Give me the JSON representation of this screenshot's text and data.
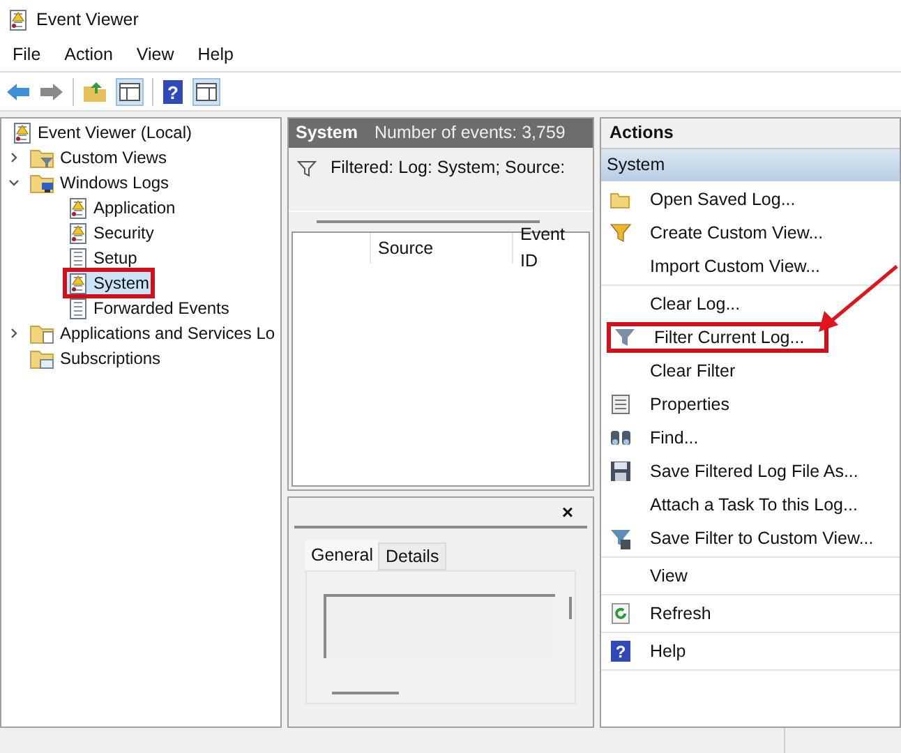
{
  "window": {
    "title": "Event Viewer"
  },
  "menu": [
    "File",
    "Action",
    "View",
    "Help"
  ],
  "toolbar": {
    "help_glyph": "?"
  },
  "tree": [
    {
      "label": "Event Viewer (Local)",
      "kind": "viewer",
      "selected": false,
      "highlighted": false,
      "children": [
        {
          "label": "Custom Views",
          "kind": "folder-filter",
          "expanded": false,
          "selected": false,
          "highlighted": false
        },
        {
          "label": "Windows Logs",
          "kind": "folder-pc",
          "expanded": true,
          "selected": false,
          "highlighted": false,
          "children": [
            {
              "label": "Application",
              "kind": "log-warn",
              "selected": false,
              "highlighted": false
            },
            {
              "label": "Security",
              "kind": "log-warn",
              "selected": false,
              "highlighted": false
            },
            {
              "label": "Setup",
              "kind": "log",
              "selected": false,
              "highlighted": false
            },
            {
              "label": "System",
              "kind": "log-warn",
              "selected": true,
              "highlighted": true
            },
            {
              "label": "Forwarded Events",
              "kind": "log",
              "selected": false,
              "highlighted": false
            }
          ]
        },
        {
          "label": "Applications and Services Lo",
          "kind": "folder",
          "expanded": false,
          "selected": false,
          "highlighted": false
        },
        {
          "label": "Subscriptions",
          "kind": "folder-sub",
          "selected": false,
          "highlighted": false
        }
      ]
    }
  ],
  "log": {
    "title": "System",
    "count": "Number of events: 3,759",
    "filter": "Filtered: Log: System; Source:",
    "columns": [
      "Source",
      "Event ID"
    ]
  },
  "preview": {
    "close": "×",
    "tabs": [
      {
        "label": "General",
        "selected": true
      },
      {
        "label": "Details",
        "selected": false
      }
    ]
  },
  "actions": {
    "title": "Actions",
    "section": "System",
    "groups": [
      [
        {
          "label": "Open Saved Log...",
          "kind": "folder",
          "highlighted": false
        },
        {
          "label": "Create Custom View...",
          "kind": "funnel",
          "highlighted": false
        },
        {
          "label": "Import Custom View...",
          "kind": "plain",
          "highlighted": false
        }
      ],
      [
        {
          "label": "Clear Log...",
          "kind": "plain",
          "highlighted": false
        },
        {
          "label": "Filter Current Log...",
          "kind": "filter",
          "highlighted": true
        },
        {
          "label": "Clear Filter",
          "kind": "plain",
          "highlighted": false
        },
        {
          "label": "Properties",
          "kind": "properties",
          "highlighted": false
        },
        {
          "label": "Find...",
          "kind": "find",
          "highlighted": false
        },
        {
          "label": "Save Filtered Log File As...",
          "kind": "save",
          "highlighted": false
        },
        {
          "label": "Attach a Task To this Log...",
          "kind": "plain",
          "highlighted": false
        },
        {
          "label": "Save Filter to Custom View...",
          "kind": "funnel-save",
          "highlighted": false
        }
      ],
      [
        {
          "label": "View",
          "kind": "plain",
          "highlighted": false
        }
      ],
      [
        {
          "label": "Refresh",
          "kind": "refresh",
          "highlighted": false
        }
      ],
      [
        {
          "label": "Help",
          "kind": "help",
          "glyph": "?",
          "highlighted": false
        }
      ]
    ]
  }
}
